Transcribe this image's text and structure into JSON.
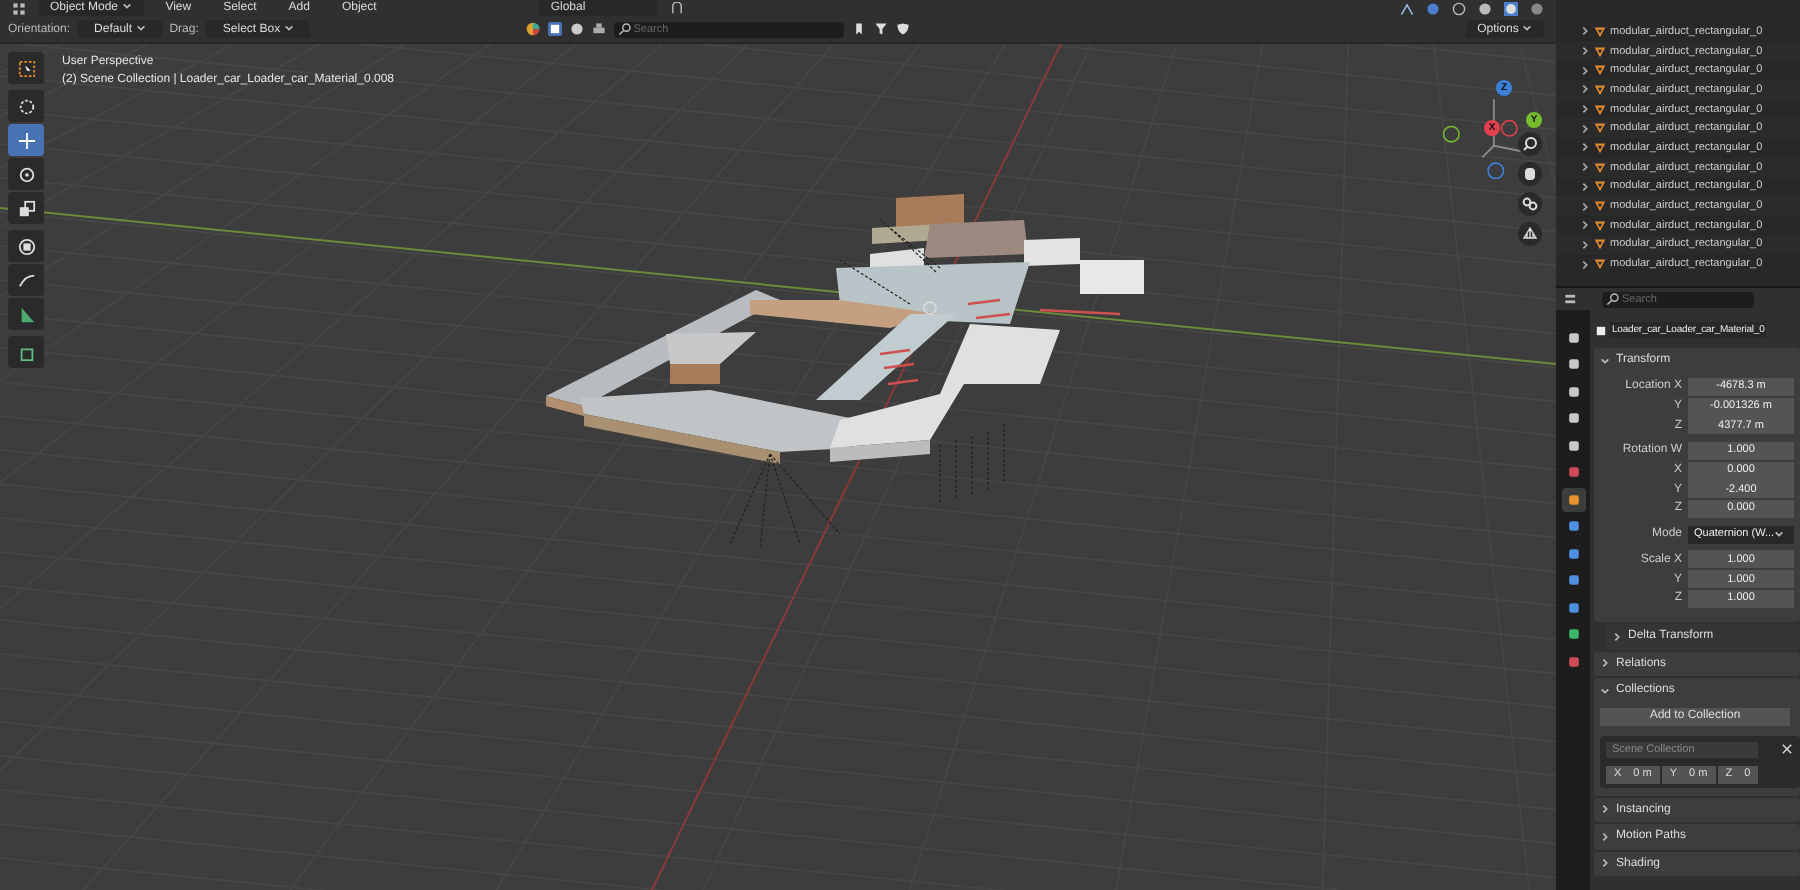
{
  "header": {
    "mode": "Object Mode",
    "menus": [
      "View",
      "Select",
      "Add",
      "Object"
    ],
    "orientation_global": "Global"
  },
  "tool_settings": {
    "orientation_label": "Orientation:",
    "orientation": "Default",
    "drag_label": "Drag:",
    "drag": "Select Box",
    "search": {
      "placeholder": "Search"
    },
    "options": "Options"
  },
  "viewport": {
    "perspective": "User Perspective",
    "collection_info": "(2) Scene Collection | Loader_car_Loader_car_Material_0.008",
    "tools": [
      {
        "kind": "select",
        "selected": false
      },
      {
        "kind": "cursor",
        "selected": false
      },
      {
        "kind": "move",
        "selected": true
      },
      {
        "kind": "rotate",
        "selected": false
      },
      {
        "kind": "scale",
        "selected": false
      },
      {
        "kind": "transform",
        "selected": false
      },
      {
        "kind": "annotate",
        "selected": false
      },
      {
        "kind": "measure",
        "selected": false
      },
      {
        "kind": "add-cube",
        "selected": false
      }
    ],
    "gizmo": [
      {
        "label": "X",
        "color": "#e5404f"
      },
      {
        "label": "Y",
        "color": "#76bb2c"
      },
      {
        "label": "Z",
        "color": "#3d80d8"
      }
    ]
  },
  "outliner": {
    "items": [
      {
        "name": "modular_airduct_rectangular_0",
        "expanded": false
      },
      {
        "name": "modular_airduct_rectangular_0",
        "expanded": false
      },
      {
        "name": "modular_airduct_rectangular_0",
        "expanded": false
      },
      {
        "name": "modular_airduct_rectangular_0",
        "expanded": false
      },
      {
        "name": "modular_airduct_rectangular_0",
        "expanded": false
      },
      {
        "name": "modular_airduct_rectangular_0",
        "expanded": false
      },
      {
        "name": "modular_airduct_rectangular_0",
        "expanded": false
      },
      {
        "name": "modular_airduct_rectangular_0",
        "expanded": false
      },
      {
        "name": "modular_airduct_rectangular_0",
        "expanded": false
      },
      {
        "name": "modular_airduct_rectangular_0",
        "expanded": false
      },
      {
        "name": "modular_airduct_rectangular_0",
        "expanded": false
      },
      {
        "name": "modular_airduct_rectangular_0",
        "expanded": false
      },
      {
        "name": "modular_airduct_rectangular_0",
        "expanded": false
      }
    ]
  },
  "properties": {
    "search": {
      "placeholder": "Search"
    },
    "object_name": "Loader_car_Loader_car_Material_0",
    "tabs": [
      {
        "kind": "tool",
        "selected": false
      },
      {
        "kind": "render",
        "selected": false
      },
      {
        "kind": "output",
        "selected": false
      },
      {
        "kind": "view-layer",
        "selected": false
      },
      {
        "kind": "scene",
        "selected": false
      },
      {
        "kind": "world",
        "selected": false
      },
      {
        "kind": "object",
        "selected": true
      },
      {
        "kind": "modifier",
        "selected": false
      },
      {
        "kind": "particles",
        "selected": false
      },
      {
        "kind": "physics",
        "selected": false
      },
      {
        "kind": "constraints",
        "selected": false
      },
      {
        "kind": "data",
        "selected": false
      },
      {
        "kind": "material",
        "selected": false
      }
    ],
    "panels": [
      {
        "kind": "fields",
        "title": "Transform",
        "expanded": true,
        "groups": [
          [
            {
              "label": "Location X",
              "value": "-4678.3 m",
              "kind": "number"
            },
            {
              "label": "Y",
              "value": "-0.001326 m",
              "kind": "number"
            },
            {
              "label": "Z",
              "value": "4377.7 m",
              "kind": "number"
            }
          ],
          [
            {
              "label": "Rotation W",
              "value": "1.000",
              "kind": "number"
            },
            {
              "label": "X",
              "value": "0.000",
              "kind": "number"
            },
            {
              "label": "Y",
              "value": "-2.400",
              "kind": "number"
            },
            {
              "label": "Z",
              "value": "0.000",
              "kind": "number"
            }
          ],
          [
            {
              "label": "Mode",
              "value": "Quaternion (W...",
              "kind": "dropdown"
            }
          ],
          [
            {
              "label": "Scale X",
              "value": "1.000",
              "kind": "number"
            },
            {
              "label": "Y",
              "value": "1.000",
              "kind": "number"
            },
            {
              "label": "Z",
              "value": "1.000",
              "kind": "number"
            }
          ]
        ]
      },
      {
        "kind": "subpanel",
        "title": "Delta Transform",
        "expanded": false
      },
      {
        "kind": "panel",
        "title": "Relations",
        "expanded": false
      },
      {
        "kind": "collections",
        "title": "Collections",
        "expanded": true,
        "button": "Add to Collection",
        "collection": "Scene Collection",
        "offset": [
          {
            "axis": "X",
            "value": "0 m"
          },
          {
            "axis": "Y",
            "value": "0 m"
          },
          {
            "axis": "Z",
            "value": "0"
          }
        ]
      },
      {
        "kind": "panel",
        "title": "Instancing",
        "expanded": false
      },
      {
        "kind": "panel",
        "title": "Motion Paths",
        "expanded": false
      },
      {
        "kind": "panel",
        "title": "Shading",
        "expanded": false
      }
    ]
  }
}
